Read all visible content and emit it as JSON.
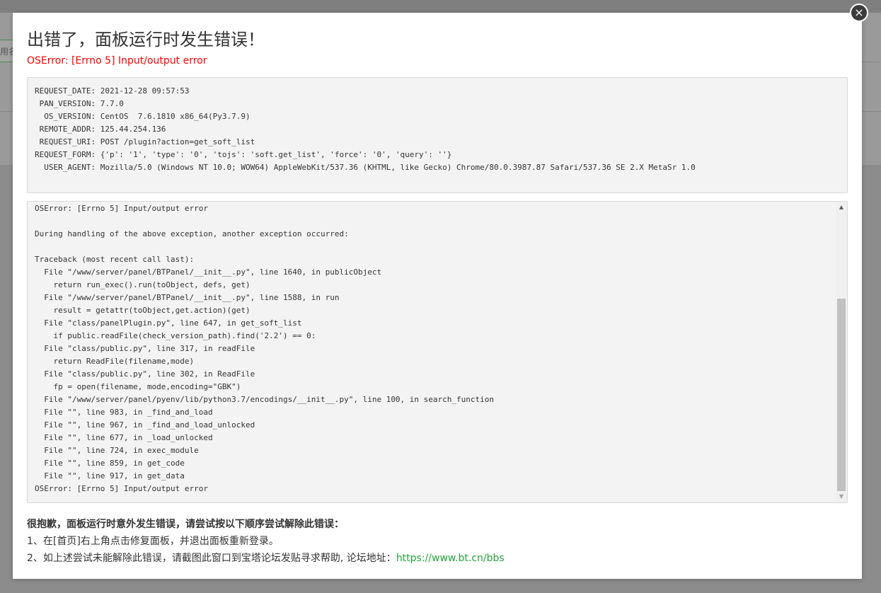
{
  "modal": {
    "title": "出错了，面板运行时发生错误！",
    "subtitle": "OSError: [Errno 5] Input/output error",
    "close_icon": "×"
  },
  "request_info": [
    "REQUEST_DATE: 2021-12-28 09:57:53",
    " PAN_VERSION: 7.7.0",
    "  OS_VERSION: CentOS  7.6.1810 x86_64(Py3.7.9)",
    " REMOTE_ADDR: 125.44.254.136",
    " REQUEST_URI: POST /plugin?action=get_soft_list",
    "REQUEST_FORM: {'p': '1', 'type': '0', 'tojs': 'soft.get_list', 'force': '0', 'query': ''}",
    "  USER_AGENT: Mozilla/5.0 (Windows NT 10.0; WOW64) AppleWebKit/537.36 (KHTML, like Gecko) Chrome/80.0.3987.87 Safari/537.36 SE 2.X MetaSr 1.0"
  ],
  "traceback": [
    "OSError: [Errno 5] Input/output error",
    "",
    "During handling of the above exception, another exception occurred:",
    "",
    "Traceback (most recent call last):",
    "  File \"/www/server/panel/BTPanel/__init__.py\", line 1640, in publicObject",
    "    return run_exec().run(toObject, defs, get)",
    "  File \"/www/server/panel/BTPanel/__init__.py\", line 1588, in run",
    "    result = getattr(toObject,get.action)(get)",
    "  File \"class/panelPlugin.py\", line 647, in get_soft_list",
    "    if public.readFile(check_version_path).find('2.2') == 0:",
    "  File \"class/public.py\", line 317, in readFile",
    "    return ReadFile(filename,mode)",
    "  File \"class/public.py\", line 302, in ReadFile",
    "    fp = open(filename, mode,encoding=\"GBK\")",
    "  File \"/www/server/panel/pyenv/lib/python3.7/encodings/__init__.py\", line 100, in search_function",
    "  File \"\", line 983, in _find_and_load",
    "  File \"\", line 967, in _find_and_load_unlocked",
    "  File \"\", line 677, in _load_unlocked",
    "  File \"\", line 724, in exec_module",
    "  File \"\", line 859, in get_code",
    "  File \"\", line 917, in get_data",
    "OSError: [Errno 5] Input/output error"
  ],
  "help": {
    "title": "很抱歉，面板运行时意外发生错误，请尝试按以下顺序尝试解除此错误：",
    "step1": "1、在[首页]右上角点击修复面板，并退出面板重新登录。",
    "step2": "2、如上述尝试未能解除此错误，请截图此窗口到宝塔论坛发贴寻求帮助, 论坛地址：",
    "link": "https://www.bt.cn/bbs"
  },
  "background": {
    "input_placeholder": "用名"
  },
  "colors": {
    "error_red": "#ff0000",
    "link_green": "#20a53a",
    "close_button": "#3c3c3c"
  },
  "icons": {
    "close": "close-icon",
    "scroll_up": "scroll-up-arrow-icon",
    "scroll_down": "scroll-down-arrow-icon"
  }
}
